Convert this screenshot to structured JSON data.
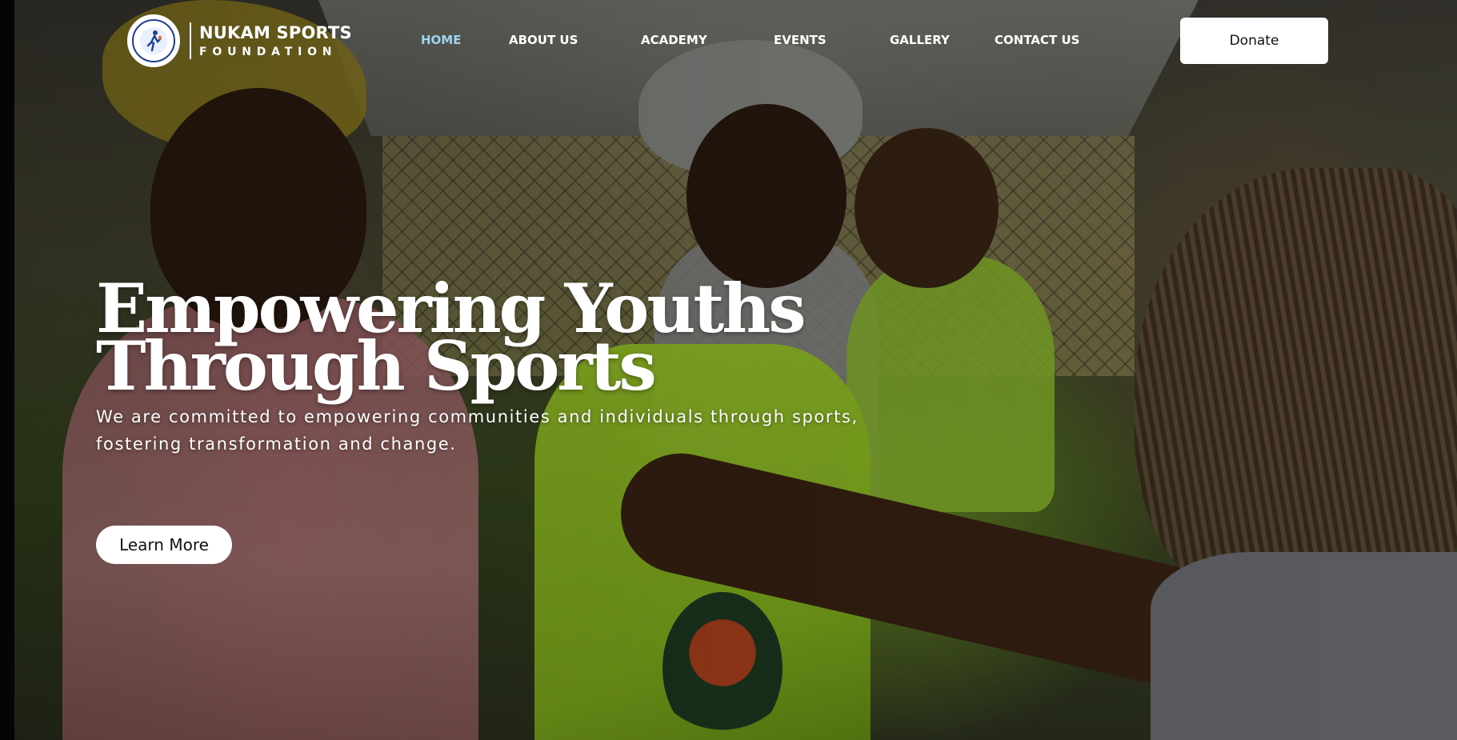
{
  "brand": {
    "name": "NUKAM SPORTS",
    "subtitle": "FOUNDATION",
    "badge_icon": "basketball-player-icon"
  },
  "nav": {
    "items": [
      {
        "label": "HOME",
        "active": true
      },
      {
        "label": "ABOUT US",
        "active": false
      },
      {
        "label": "ACADEMY",
        "active": false
      },
      {
        "label": "EVENTS",
        "active": false
      },
      {
        "label": "GALLERY",
        "active": false
      },
      {
        "label": "CONTACT US",
        "active": false
      }
    ],
    "donate_label": "Donate"
  },
  "hero": {
    "title_line1": "Empowering Youths",
    "title_line2": "Through Sports",
    "description_line1": "We are committed to empowering communities and individuals through sports,",
    "description_line2": "fostering transformation and change.",
    "cta_label": "Learn More"
  },
  "colors": {
    "nav_active": "#9fd3ef",
    "nav_text": "#ffffff",
    "button_bg": "#ffffff",
    "button_text": "#111111",
    "badge_ring": "#1d3f8f"
  }
}
